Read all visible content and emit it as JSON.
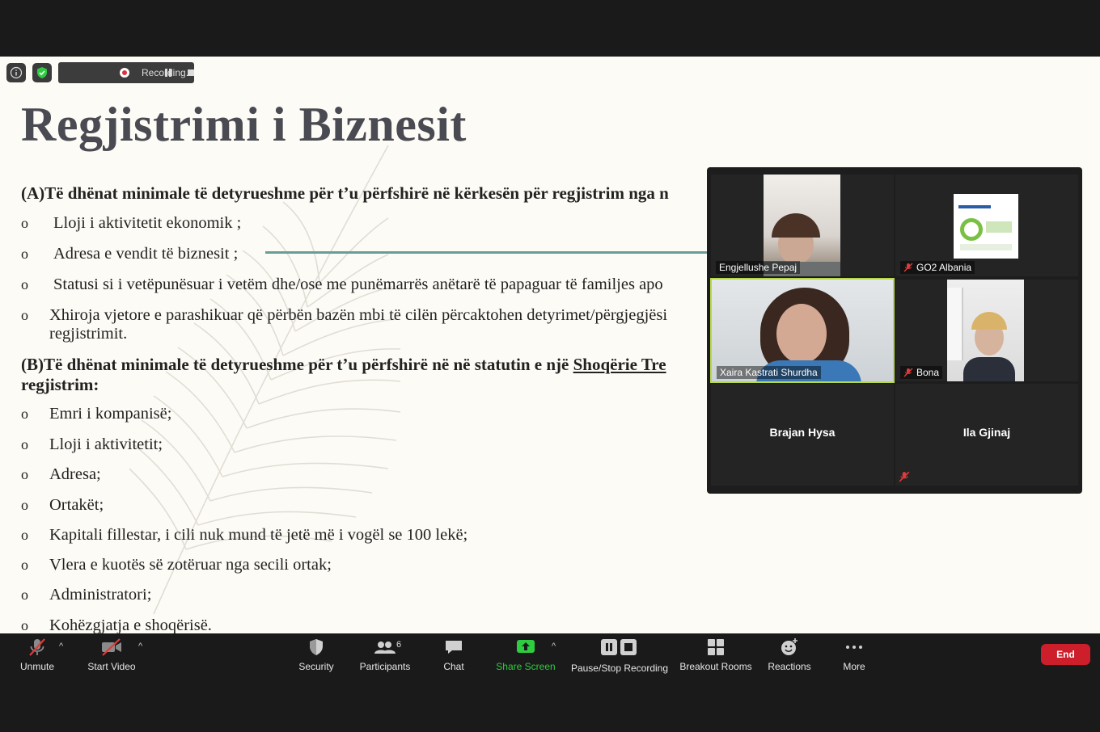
{
  "recording": {
    "label": "Recording..."
  },
  "slide": {
    "title": "Regjistrimi i Biznesit",
    "section_a_heading": "(A)Të dhënat minimale të detyrueshme për t’u përfshirë në kërkesën për regjistrim nga n",
    "section_a_items": [
      "Lloji i aktivitetit ekonomik ;",
      "Adresa e vendit të biznesit ;",
      "Statusi si i vetëpunësuar i vetëm dhe/ose me punëmarrës anëtarë të papaguar të familjes apo",
      "Xhiroja vjetore e parashikuar që përbën bazën mbi të cilën përcaktohen detyrimet/përgjegjësi"
    ],
    "section_a_item4_cont": "regjistrimit.",
    "section_b_heading_pre": "(B)Të dhënat minimale të detyrueshme për t’u përfshirë në në statutin e një ",
    "section_b_heading_link": "Shoqërie Tre",
    "section_b_heading_line2": "regjistrim:",
    "section_b_items": [
      "Emri i kompanisë;",
      "Lloji i aktivitetit;",
      "Adresa;",
      "Ortakët;",
      "Kapitali fillestar, i cili nuk mund të jetë më i vogël se 100 lekë;",
      "Vlera e kuotës së zotëruar nga secili ortak;",
      "Administratori;",
      "Kohëzgjatja e shoqërisë."
    ]
  },
  "participants_gallery": [
    {
      "name": "Engjellushe Pepaj",
      "muted": false
    },
    {
      "name": "GO2 Albania",
      "muted": true
    },
    {
      "name": "Xaira Kastrati Shurdha",
      "muted": false,
      "active_speaker": true
    },
    {
      "name": "Bona",
      "muted": true
    },
    {
      "name": "Brajan Hysa",
      "muted": false
    },
    {
      "name": "Ila Gjinaj",
      "muted": true
    }
  ],
  "toolbar": {
    "unmute": "Unmute",
    "start_video": "Start Video",
    "security": "Security",
    "participants": "Participants",
    "participants_count": "6",
    "chat": "Chat",
    "share_screen": "Share Screen",
    "pause_stop_recording": "Pause/Stop Recording",
    "breakout_rooms": "Breakout Rooms",
    "reactions": "Reactions",
    "more": "More",
    "end": "End"
  },
  "colors": {
    "share_green": "#2ecc40",
    "end_red": "#cc1f2b",
    "active_border": "#b6d94a",
    "teal_line": "#6a9c98"
  }
}
